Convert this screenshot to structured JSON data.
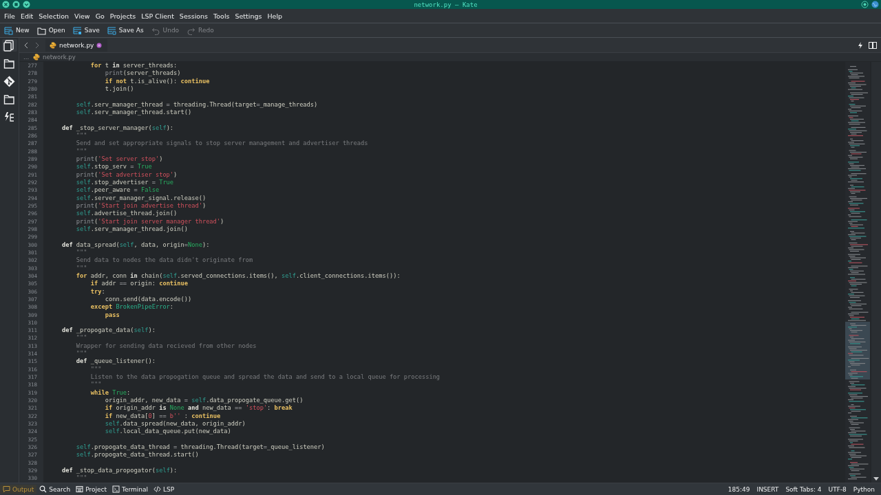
{
  "window": {
    "title": "network.py — Kate"
  },
  "menu": [
    "File",
    "Edit",
    "Selection",
    "View",
    "Go",
    "Projects",
    "LSP Client",
    "Sessions",
    "Tools",
    "Settings",
    "Help"
  ],
  "toolbar": [
    {
      "label": "New",
      "kind": "new",
      "disabled": false
    },
    {
      "label": "Open",
      "kind": "open",
      "disabled": false
    },
    {
      "label": "Save",
      "kind": "save",
      "disabled": false
    },
    {
      "label": "Save As",
      "kind": "saveas",
      "disabled": false
    },
    {
      "label": "Undo",
      "kind": "undo",
      "disabled": true
    },
    {
      "label": "Redo",
      "kind": "redo",
      "disabled": true
    }
  ],
  "sidebar": [
    {
      "kind": "documents",
      "selected": true
    },
    {
      "kind": "folder",
      "selected": false
    },
    {
      "kind": "git",
      "selected": false
    },
    {
      "kind": "folder",
      "selected": false
    },
    {
      "kind": "symbols",
      "selected": false
    }
  ],
  "tabs": [
    {
      "label": "network.py",
      "modified": true,
      "selected": true
    }
  ],
  "breadcrumb": {
    "ellipsis": "...",
    "file": "network.py"
  },
  "lines": [
    {
      "number": "277",
      "tokens": [
        {
          "kind": "flow",
          "text": "            for"
        },
        {
          "kind": "plain",
          "text": " t "
        },
        {
          "kind": "keyword",
          "text": "in"
        },
        {
          "kind": "plain",
          "text": " server_threads:"
        }
      ]
    },
    {
      "number": "278",
      "tokens": [
        {
          "kind": "builtin",
          "text": "                print"
        },
        {
          "kind": "plain",
          "text": "(server_threads)"
        }
      ]
    },
    {
      "number": "279",
      "tokens": [
        {
          "kind": "flow",
          "text": "                if"
        },
        {
          "kind": "flow",
          "text": " not"
        },
        {
          "kind": "plain",
          "text": " t.is_alive(): "
        },
        {
          "kind": "flow",
          "text": "continue"
        }
      ]
    },
    {
      "number": "280",
      "tokens": [
        {
          "kind": "plain",
          "text": "                t.join()"
        }
      ]
    },
    {
      "number": "281"
    },
    {
      "number": "282",
      "tokens": [
        {
          "kind": "self",
          "text": "        self"
        },
        {
          "kind": "plain",
          "text": ".serv_manager_thread "
        },
        {
          "kind": "op",
          "text": "="
        },
        {
          "kind": "plain",
          "text": " threading.Thread(target"
        },
        {
          "kind": "op",
          "text": "="
        },
        {
          "kind": "plain",
          "text": "_manage_threads)"
        }
      ]
    },
    {
      "number": "283",
      "tokens": [
        {
          "kind": "self",
          "text": "        self"
        },
        {
          "kind": "plain",
          "text": ".serv_manager_thread.start()"
        }
      ]
    },
    {
      "number": "284"
    },
    {
      "number": "285",
      "tokens": [
        {
          "kind": "keyword",
          "text": "    def"
        },
        {
          "kind": "plain",
          "text": " _stop_server_manager("
        },
        {
          "kind": "self",
          "text": "self"
        },
        {
          "kind": "plain",
          "text": "):"
        }
      ]
    },
    {
      "number": "286",
      "tokens": [
        {
          "kind": "doc",
          "text": "        \"\"\""
        }
      ]
    },
    {
      "number": "287",
      "tokens": [
        {
          "kind": "doc",
          "text": "        Send and set appropriate signals to stop server management and advertiser threads"
        }
      ]
    },
    {
      "number": "288",
      "tokens": [
        {
          "kind": "doc",
          "text": "        \"\"\""
        }
      ]
    },
    {
      "number": "289",
      "tokens": [
        {
          "kind": "builtin",
          "text": "        print"
        },
        {
          "kind": "plain",
          "text": "("
        },
        {
          "kind": "string",
          "text": "'Set server stop'"
        },
        {
          "kind": "plain",
          "text": ")"
        }
      ]
    },
    {
      "number": "290",
      "tokens": [
        {
          "kind": "self",
          "text": "        self"
        },
        {
          "kind": "plain",
          "text": ".stop_serv "
        },
        {
          "kind": "op",
          "text": "="
        },
        {
          "kind": "const",
          "text": " True"
        }
      ]
    },
    {
      "number": "291",
      "tokens": [
        {
          "kind": "builtin",
          "text": "        print"
        },
        {
          "kind": "plain",
          "text": "("
        },
        {
          "kind": "string",
          "text": "'Set advertiser stop'"
        },
        {
          "kind": "plain",
          "text": ")"
        }
      ]
    },
    {
      "number": "292",
      "tokens": [
        {
          "kind": "self",
          "text": "        self"
        },
        {
          "kind": "plain",
          "text": ".stop_advertiser "
        },
        {
          "kind": "op",
          "text": "="
        },
        {
          "kind": "const",
          "text": " True"
        }
      ]
    },
    {
      "number": "293",
      "tokens": [
        {
          "kind": "self",
          "text": "        self"
        },
        {
          "kind": "plain",
          "text": ".peer_aware "
        },
        {
          "kind": "op",
          "text": "="
        },
        {
          "kind": "const",
          "text": " False"
        }
      ]
    },
    {
      "number": "294",
      "tokens": [
        {
          "kind": "self",
          "text": "        self"
        },
        {
          "kind": "plain",
          "text": ".server_manager_signal.release()"
        }
      ]
    },
    {
      "number": "295",
      "tokens": [
        {
          "kind": "builtin",
          "text": "        print"
        },
        {
          "kind": "plain",
          "text": "("
        },
        {
          "kind": "string",
          "text": "'Start join advertise thread'"
        },
        {
          "kind": "plain",
          "text": ")"
        }
      ]
    },
    {
      "number": "296",
      "tokens": [
        {
          "kind": "self",
          "text": "        self"
        },
        {
          "kind": "plain",
          "text": ".advertise_thread.join()"
        }
      ]
    },
    {
      "number": "297",
      "tokens": [
        {
          "kind": "builtin",
          "text": "        print"
        },
        {
          "kind": "plain",
          "text": "("
        },
        {
          "kind": "string",
          "text": "'Start join server manager thread'"
        },
        {
          "kind": "plain",
          "text": ")"
        }
      ]
    },
    {
      "number": "298",
      "tokens": [
        {
          "kind": "self",
          "text": "        self"
        },
        {
          "kind": "plain",
          "text": ".serv_manager_thread.join()"
        }
      ]
    },
    {
      "number": "299"
    },
    {
      "number": "300",
      "tokens": [
        {
          "kind": "keyword",
          "text": "    def"
        },
        {
          "kind": "plain",
          "text": " data_spread("
        },
        {
          "kind": "self",
          "text": "self"
        },
        {
          "kind": "plain",
          "text": ", data, origin"
        },
        {
          "kind": "op",
          "text": "="
        },
        {
          "kind": "const",
          "text": "None"
        },
        {
          "kind": "plain",
          "text": "):"
        }
      ]
    },
    {
      "number": "301",
      "tokens": [
        {
          "kind": "doc",
          "text": "        \"\"\""
        }
      ]
    },
    {
      "number": "302",
      "tokens": [
        {
          "kind": "doc",
          "text": "        Send data to nodes the data didn't originate from"
        }
      ]
    },
    {
      "number": "303",
      "tokens": [
        {
          "kind": "doc",
          "text": "        \"\"\""
        }
      ]
    },
    {
      "number": "304",
      "tokens": [
        {
          "kind": "flow",
          "text": "        for"
        },
        {
          "kind": "plain",
          "text": " addr, conn "
        },
        {
          "kind": "keyword",
          "text": "in"
        },
        {
          "kind": "plain",
          "text": " chain("
        },
        {
          "kind": "self",
          "text": "self"
        },
        {
          "kind": "plain",
          "text": ".served_connections.items(), "
        },
        {
          "kind": "self",
          "text": "self"
        },
        {
          "kind": "plain",
          "text": ".client_connections.items()):"
        }
      ]
    },
    {
      "number": "305",
      "tokens": [
        {
          "kind": "flow",
          "text": "            if"
        },
        {
          "kind": "plain",
          "text": " addr "
        },
        {
          "kind": "op",
          "text": "=="
        },
        {
          "kind": "plain",
          "text": " origin: "
        },
        {
          "kind": "flow",
          "text": "continue"
        }
      ]
    },
    {
      "number": "306",
      "tokens": [
        {
          "kind": "flow",
          "text": "            try"
        },
        {
          "kind": "plain",
          "text": ":"
        }
      ]
    },
    {
      "number": "307",
      "tokens": [
        {
          "kind": "plain",
          "text": "                conn.send(data.encode())"
        }
      ]
    },
    {
      "number": "308",
      "tokens": [
        {
          "kind": "flow",
          "text": "            except"
        },
        {
          "kind": "type",
          "text": " BrokenPipeError"
        },
        {
          "kind": "plain",
          "text": ":"
        }
      ]
    },
    {
      "number": "309",
      "tokens": [
        {
          "kind": "flow",
          "text": "                pass"
        }
      ]
    },
    {
      "number": "310"
    },
    {
      "number": "311",
      "tokens": [
        {
          "kind": "keyword",
          "text": "    def"
        },
        {
          "kind": "plain",
          "text": " _propogate_data("
        },
        {
          "kind": "self",
          "text": "self"
        },
        {
          "kind": "plain",
          "text": "):"
        }
      ]
    },
    {
      "number": "312",
      "tokens": [
        {
          "kind": "doc",
          "text": "        \"\"\""
        }
      ]
    },
    {
      "number": "313",
      "tokens": [
        {
          "kind": "doc",
          "text": "        Wrapper for sending data recieved from other nodes"
        }
      ]
    },
    {
      "number": "314",
      "tokens": [
        {
          "kind": "doc",
          "text": "        \"\"\""
        }
      ]
    },
    {
      "number": "315",
      "tokens": [
        {
          "kind": "keyword",
          "text": "        def"
        },
        {
          "kind": "plain",
          "text": " _queue_listener():"
        }
      ]
    },
    {
      "number": "316",
      "tokens": [
        {
          "kind": "doc",
          "text": "            \"\"\""
        }
      ]
    },
    {
      "number": "317",
      "tokens": [
        {
          "kind": "doc",
          "text": "            Listen to the data propogation queue and spread the data and send to a local queue for processing"
        }
      ]
    },
    {
      "number": "318",
      "tokens": [
        {
          "kind": "doc",
          "text": "            \"\"\""
        }
      ]
    },
    {
      "number": "319",
      "tokens": [
        {
          "kind": "flow",
          "text": "            while"
        },
        {
          "kind": "const",
          "text": " True"
        },
        {
          "kind": "plain",
          "text": ":"
        }
      ]
    },
    {
      "number": "320",
      "tokens": [
        {
          "kind": "plain",
          "text": "                origin_addr, new_data "
        },
        {
          "kind": "op",
          "text": "="
        },
        {
          "kind": "self",
          "text": " self"
        },
        {
          "kind": "plain",
          "text": ".data_propogate_queue.get()"
        }
      ]
    },
    {
      "number": "321",
      "tokens": [
        {
          "kind": "flow",
          "text": "                if"
        },
        {
          "kind": "plain",
          "text": " origin_addr "
        },
        {
          "kind": "keyword",
          "text": "is"
        },
        {
          "kind": "const",
          "text": " None"
        },
        {
          "kind": "keyword",
          "text": " and"
        },
        {
          "kind": "plain",
          "text": " new_data "
        },
        {
          "kind": "op",
          "text": "=="
        },
        {
          "kind": "string",
          "text": " 'stop'"
        },
        {
          "kind": "plain",
          "text": ": "
        },
        {
          "kind": "flow",
          "text": "break"
        }
      ]
    },
    {
      "number": "322",
      "tokens": [
        {
          "kind": "flow",
          "text": "                if"
        },
        {
          "kind": "plain",
          "text": " new_data["
        },
        {
          "kind": "number",
          "text": "0"
        },
        {
          "kind": "plain",
          "text": "] "
        },
        {
          "kind": "op",
          "text": "=="
        },
        {
          "kind": "string",
          "text": " b''"
        },
        {
          "kind": "plain",
          "text": " : "
        },
        {
          "kind": "flow",
          "text": "continue"
        }
      ]
    },
    {
      "number": "323",
      "tokens": [
        {
          "kind": "self",
          "text": "                self"
        },
        {
          "kind": "plain",
          "text": ".data_spread(new_data, origin_addr)"
        }
      ]
    },
    {
      "number": "324",
      "tokens": [
        {
          "kind": "self",
          "text": "                self"
        },
        {
          "kind": "plain",
          "text": ".local_data_queue.put(new_data)"
        }
      ]
    },
    {
      "number": "325"
    },
    {
      "number": "326",
      "tokens": [
        {
          "kind": "self",
          "text": "        self"
        },
        {
          "kind": "plain",
          "text": ".propogate_data_thread "
        },
        {
          "kind": "op",
          "text": "="
        },
        {
          "kind": "plain",
          "text": " threading.Thread(target"
        },
        {
          "kind": "op",
          "text": "="
        },
        {
          "kind": "plain",
          "text": "_queue_listener)"
        }
      ]
    },
    {
      "number": "327",
      "tokens": [
        {
          "kind": "self",
          "text": "        self"
        },
        {
          "kind": "plain",
          "text": ".propogate_data_thread.start()"
        }
      ]
    },
    {
      "number": "328"
    },
    {
      "number": "329",
      "tokens": [
        {
          "kind": "keyword",
          "text": "    def"
        },
        {
          "kind": "plain",
          "text": " _stop_data_propogator("
        },
        {
          "kind": "self",
          "text": "self"
        },
        {
          "kind": "plain",
          "text": "):"
        }
      ]
    },
    {
      "number": "330",
      "tokens": [
        {
          "kind": "doc",
          "text": "        \"\"\""
        }
      ]
    }
  ],
  "panels": [
    {
      "label": "Output",
      "kind": "output",
      "selected": true
    },
    {
      "label": "Search",
      "kind": "search",
      "selected": false
    },
    {
      "label": "Project",
      "kind": "project",
      "selected": false
    },
    {
      "label": "Terminal",
      "kind": "terminal",
      "selected": false
    },
    {
      "label": "LSP",
      "kind": "lsp",
      "selected": false
    }
  ],
  "status": [
    "185:49",
    "INSERT",
    "Soft Tabs: 4",
    "UTF-8",
    "Python"
  ]
}
